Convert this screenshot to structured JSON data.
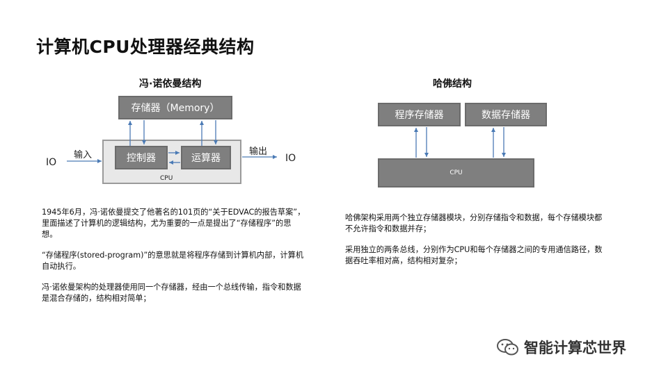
{
  "slide": {
    "title": "计算机CPU处理器经典结构"
  },
  "von_neumann": {
    "heading": "冯·诺依曼结构",
    "memory_label": "存储器（Memory）",
    "controller_label": "控制器",
    "alu_label": "运算器",
    "cpu_label": "CPU",
    "io_left": "IO",
    "io_right": "IO",
    "input_label": "输入",
    "output_label": "输出",
    "paragraphs": [
      "1945年6月，冯·诺依曼提交了他著名的101页的“关于EDVAC的报告草案”，里面描述了计算机的逻辑结构，尤为重要的一点是提出了“存储程序”的思想。",
      "“存储程序(stored-program)”的意思就是将程序存储到计算机内部，计算机自动执行。",
      "冯·诺依曼架构的处理器使用同一个存储器，经由一个总线传输，指令和数据是混合存储的，结构相对简单；"
    ]
  },
  "harvard": {
    "heading": "哈佛结构",
    "program_memory_label": "程序存储器",
    "data_memory_label": "数据存储器",
    "cpu_label": "CPU",
    "paragraphs": [
      "哈佛架构采用两个独立存储器模块，分别存储指令和数据，每个存储模块都不允许指令和数据并存；",
      "采用独立的两条总线，分别作为CPU和每个存储器之间的专用通信路径，数据吞吐率相对高，结构相对复杂；"
    ]
  },
  "watermark": {
    "text": "智能计算芯世界",
    "icon": "wechat-icon"
  },
  "colors": {
    "box_fill": "#7f7f7f",
    "cpu_fill": "#e8e8e8",
    "arrow": "#4a7ab5"
  }
}
